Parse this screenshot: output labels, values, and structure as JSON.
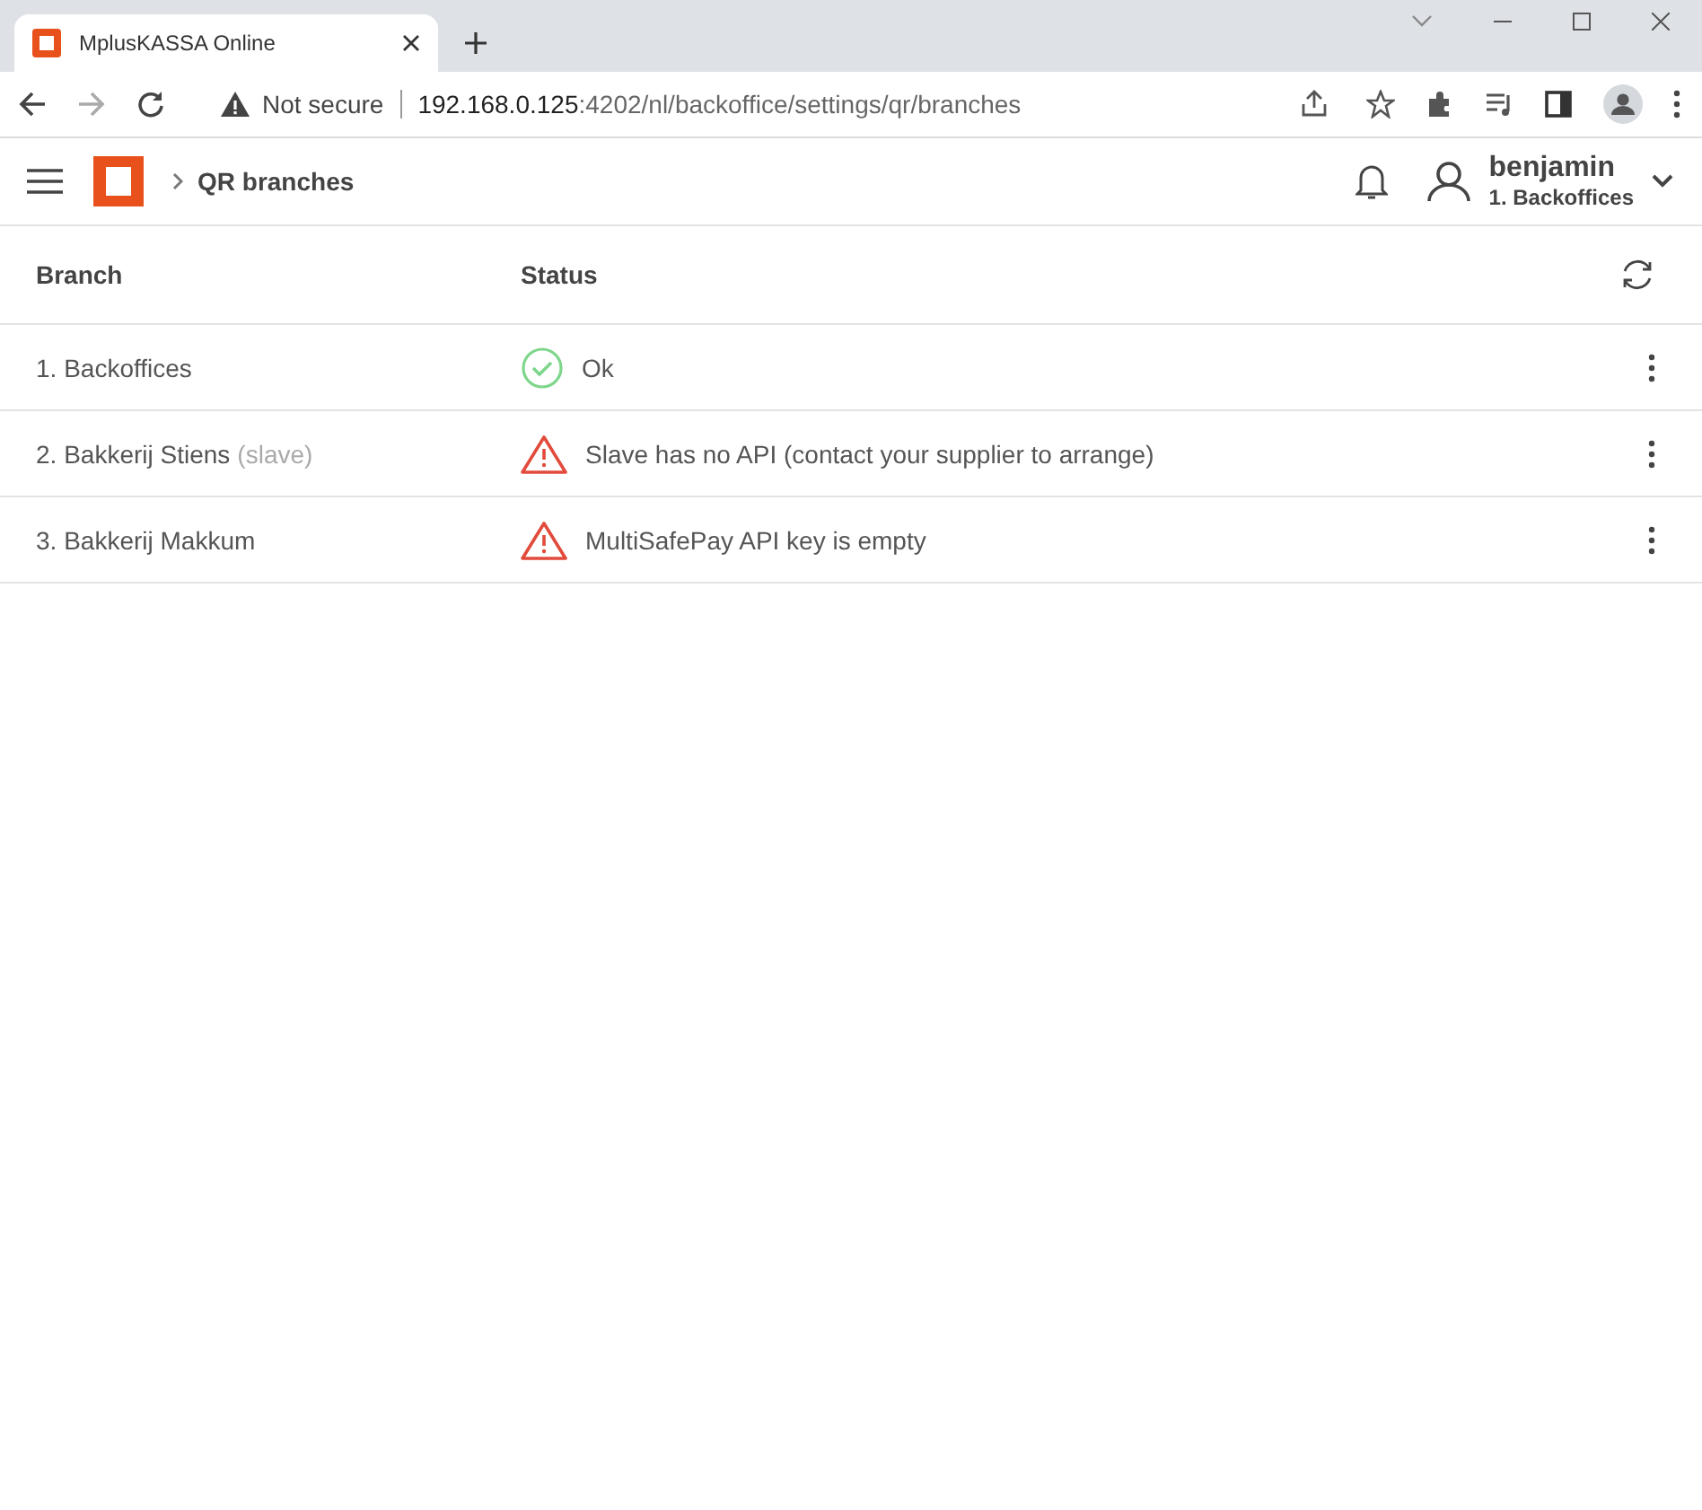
{
  "browser": {
    "tab_title": "MplusKASSA Online",
    "security": "Not secure",
    "url_host": "192.168.0.125",
    "url_path": ":4202/nl/backoffice/settings/qr/branches"
  },
  "header": {
    "breadcrumb": "QR branches",
    "user_name": "benjamin",
    "user_branch": "1. Backoffices"
  },
  "table": {
    "columns": [
      "Branch",
      "Status"
    ],
    "rows": [
      {
        "branch": "1. Backoffices",
        "kind": "ok",
        "status": "Ok"
      },
      {
        "branch": "2. Bakkerij Stiens",
        "note": "(slave)",
        "kind": "warning",
        "status": "Slave has no API (contact your supplier to arrange)"
      },
      {
        "branch": "3. Bakkerij Makkum",
        "kind": "warning",
        "status": "MultiSafePay API key is empty"
      }
    ]
  }
}
